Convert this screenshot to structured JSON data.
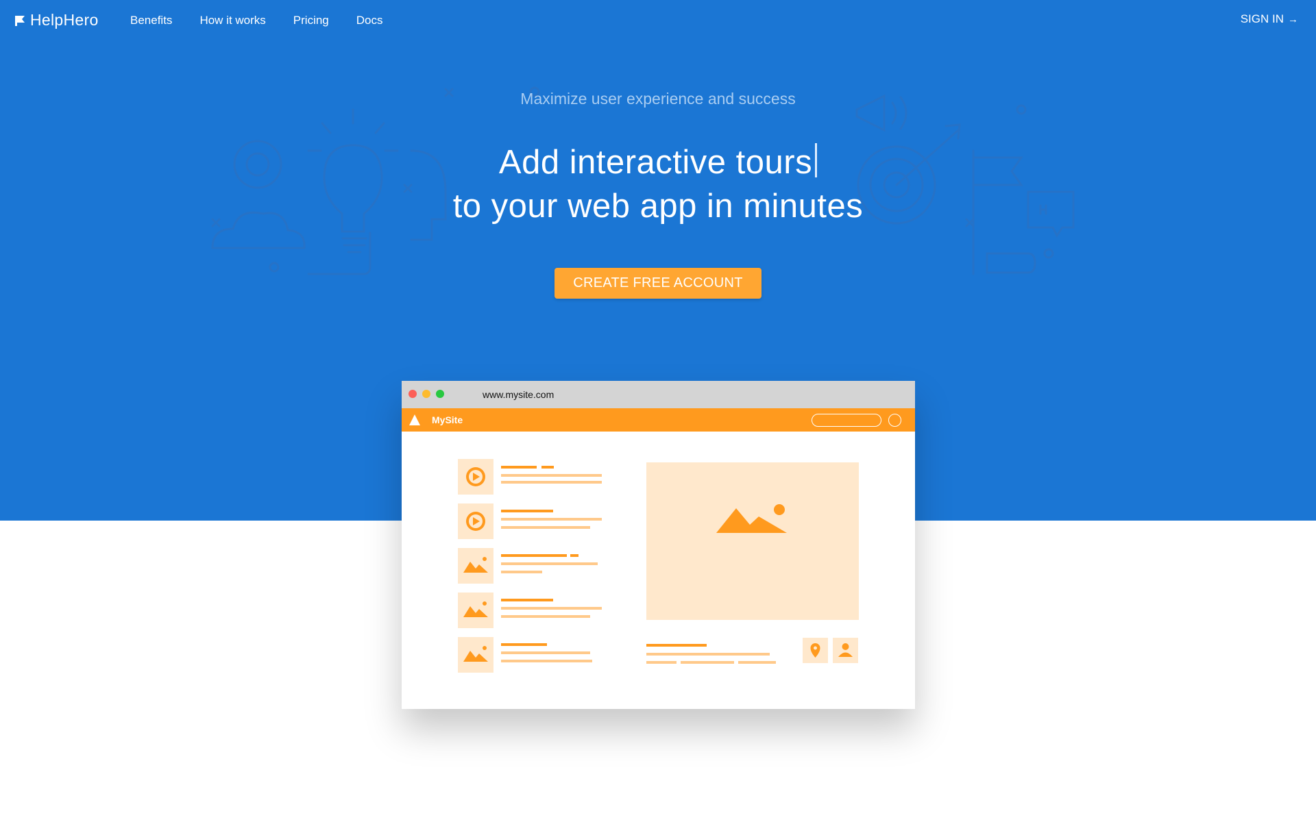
{
  "brand": {
    "name": "HelpHero",
    "logo_icon": "flag-icon"
  },
  "nav": {
    "items": [
      {
        "label": "Benefits"
      },
      {
        "label": "How it works"
      },
      {
        "label": "Pricing"
      },
      {
        "label": "Docs"
      }
    ],
    "signin_label": "SIGN IN",
    "signin_icon": "arrow-right-icon"
  },
  "hero": {
    "tagline": "Maximize user experience and success",
    "headline_line1": "Add interactive tours",
    "headline_line2": "to your web app in minutes",
    "cta_label": "CREATE FREE ACCOUNT"
  },
  "mockup": {
    "url": "www.mysite.com",
    "site_name": "MySite"
  },
  "colors": {
    "hero_bg": "#1b76d4",
    "cta": "#ffa632",
    "mock_accent": "#ff9a1e",
    "mock_light": "#ffe8cc"
  }
}
